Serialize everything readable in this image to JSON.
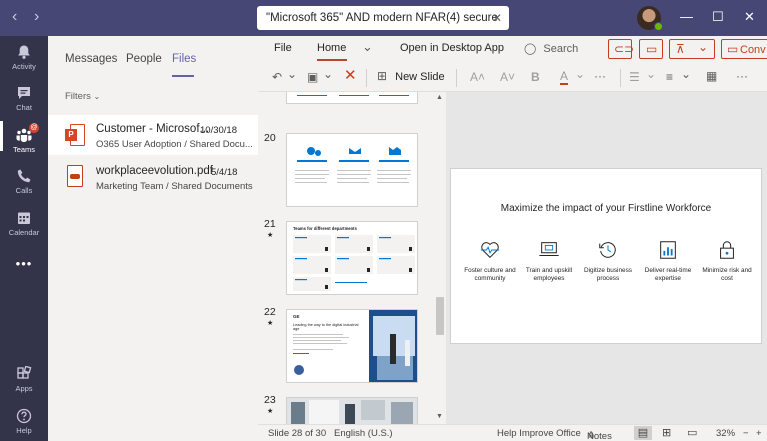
{
  "titlebar": {
    "back_glyph": "‹",
    "forward_glyph": "›",
    "search_value": "\"Microsoft 365\" AND modern NFAR(4) secure",
    "clear_glyph": "✕",
    "minimize_glyph": "—",
    "maximize_glyph": "☐",
    "close_glyph": "✕",
    "presence_color": "#6bb700"
  },
  "rail": {
    "items": [
      {
        "label": "Activity",
        "icon": "bell-icon"
      },
      {
        "label": "Chat",
        "icon": "chat-icon"
      },
      {
        "label": "Teams",
        "icon": "teams-icon",
        "badge": "@"
      },
      {
        "label": "Calls",
        "icon": "phone-icon"
      },
      {
        "label": "Calendar",
        "icon": "calendar-icon"
      },
      {
        "label": "•••",
        "icon": "more-icon"
      },
      {
        "label": "Apps",
        "icon": "apps-icon"
      },
      {
        "label": "Help",
        "icon": "help-icon"
      }
    ]
  },
  "panel": {
    "tabs": [
      "Messages",
      "People",
      "Files"
    ],
    "filters_label": "Filters",
    "files": [
      {
        "name": "Customer - Microsof...",
        "date": "10/30/18",
        "path": "O365 User Adoption / Shared Docu...",
        "type": "pptx"
      },
      {
        "name": "workplaceevolution.pdf",
        "date": "5/4/18",
        "path": "Marketing Team / Shared Documents",
        "type": "pdf"
      }
    ]
  },
  "ribbon": {
    "tabs": [
      "File",
      "Home",
      "Open in Desktop App"
    ],
    "collapse_glyph": "⌄",
    "search_label": "Search",
    "conv_label": "Conv",
    "new_slide_label": "New Slide",
    "more_glyph": "···",
    "font_grow": "A˄",
    "font_shrink": "A˅",
    "bold": "B",
    "font_color_letter": "A",
    "accent_color": "#c43e1c"
  },
  "thumbnails": {
    "slides": [
      {
        "number": "20",
        "star": ""
      },
      {
        "number": "21",
        "star": "★"
      },
      {
        "number": "22",
        "star": "★"
      },
      {
        "number": "23",
        "star": "★"
      }
    ],
    "slide21_title": "Teams for different departments",
    "slide22_label": "GE",
    "slide22_heading": "Leading the way to the digital industrial age"
  },
  "slide": {
    "title": "Maximize the impact of your Firstline Workforce",
    "features": [
      {
        "label": "Foster culture and community",
        "icon": "heart-pulse-icon"
      },
      {
        "label": "Train and upskill employees",
        "icon": "laptop-icon"
      },
      {
        "label": "Digitize business process",
        "icon": "history-icon"
      },
      {
        "label": "Deliver real-time expertise",
        "icon": "chart-icon"
      },
      {
        "label": "Minimize risk and cost",
        "icon": "lock-icon"
      }
    ]
  },
  "status": {
    "slide_counter": "Slide 28 of 30",
    "language": "English (U.S.)",
    "help": "Help Improve Office",
    "notes": "Notes",
    "zoom": "32%",
    "zoom_minus": "−",
    "zoom_plus": "+"
  }
}
